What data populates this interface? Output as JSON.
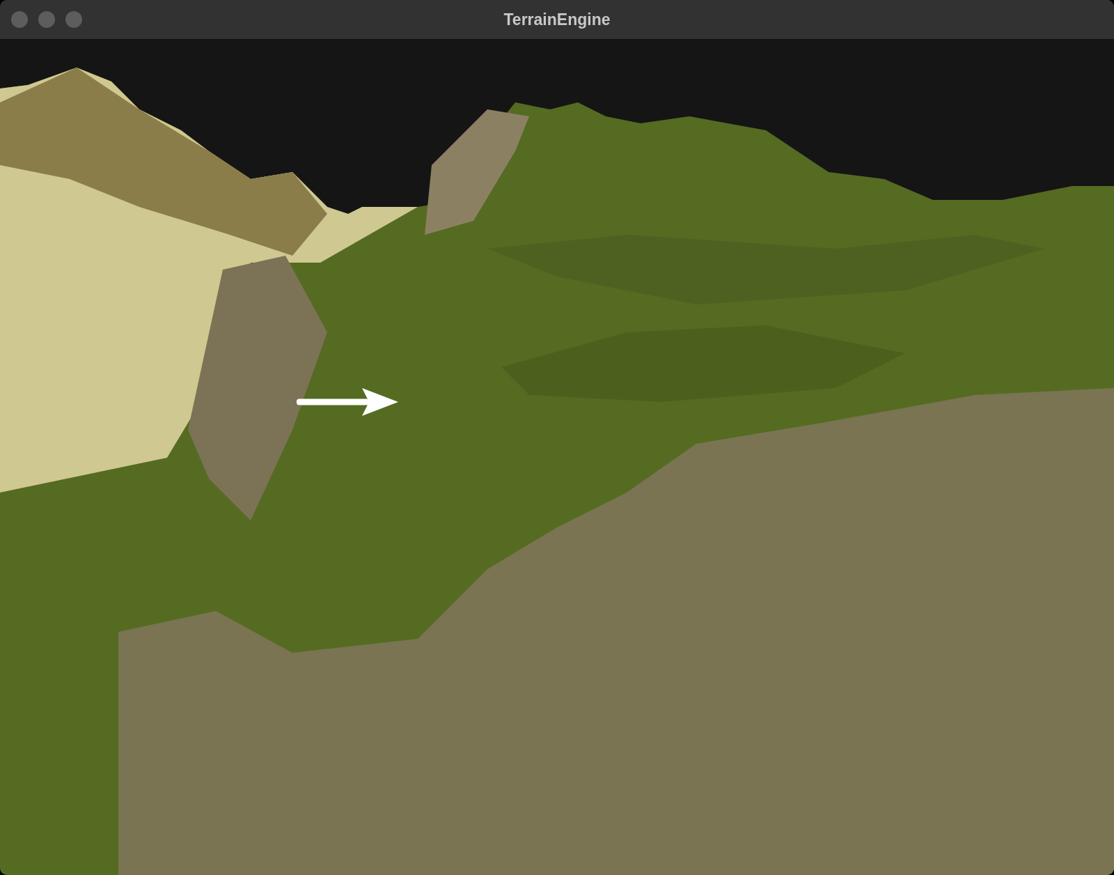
{
  "window": {
    "title": "TerrainEngine"
  }
}
